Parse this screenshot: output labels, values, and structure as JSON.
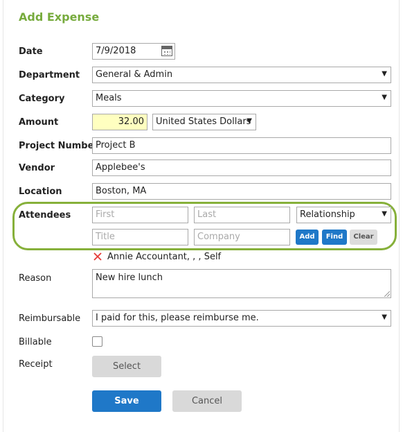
{
  "title": "Add Expense",
  "labels": {
    "date": "Date",
    "department": "Department",
    "category": "Category",
    "amount": "Amount",
    "project_number": "Project Number",
    "vendor": "Vendor",
    "location": "Location",
    "attendees": "Attendees",
    "reason": "Reason",
    "reimbursable": "Reimbursable",
    "billable": "Billable",
    "receipt": "Receipt"
  },
  "fields": {
    "date": "7/9/2018",
    "department": "General & Admin",
    "category": "Meals",
    "amount": "32.00",
    "currency": "United States Dollars",
    "project_number": "Project B",
    "vendor": "Applebee's",
    "location": "Boston, MA",
    "reason": "New hire lunch",
    "reimbursable": "I paid for this, please reimburse me."
  },
  "attendees": {
    "first_placeholder": "First",
    "last_placeholder": "Last",
    "relationship": "Relationship",
    "title_placeholder": "Title",
    "company_placeholder": "Company",
    "add_label": "Add",
    "find_label": "Find",
    "clear_label": "Clear",
    "list": [
      "Annie Accountant, , , Self"
    ]
  },
  "buttons": {
    "select": "Select",
    "save": "Save",
    "cancel": "Cancel"
  },
  "colors": {
    "accent_green": "#77ab3d",
    "highlight_green": "#86b03a",
    "primary_blue": "#1f78c8",
    "amount_bg": "#ffffc0",
    "remove_red": "#e53935"
  }
}
